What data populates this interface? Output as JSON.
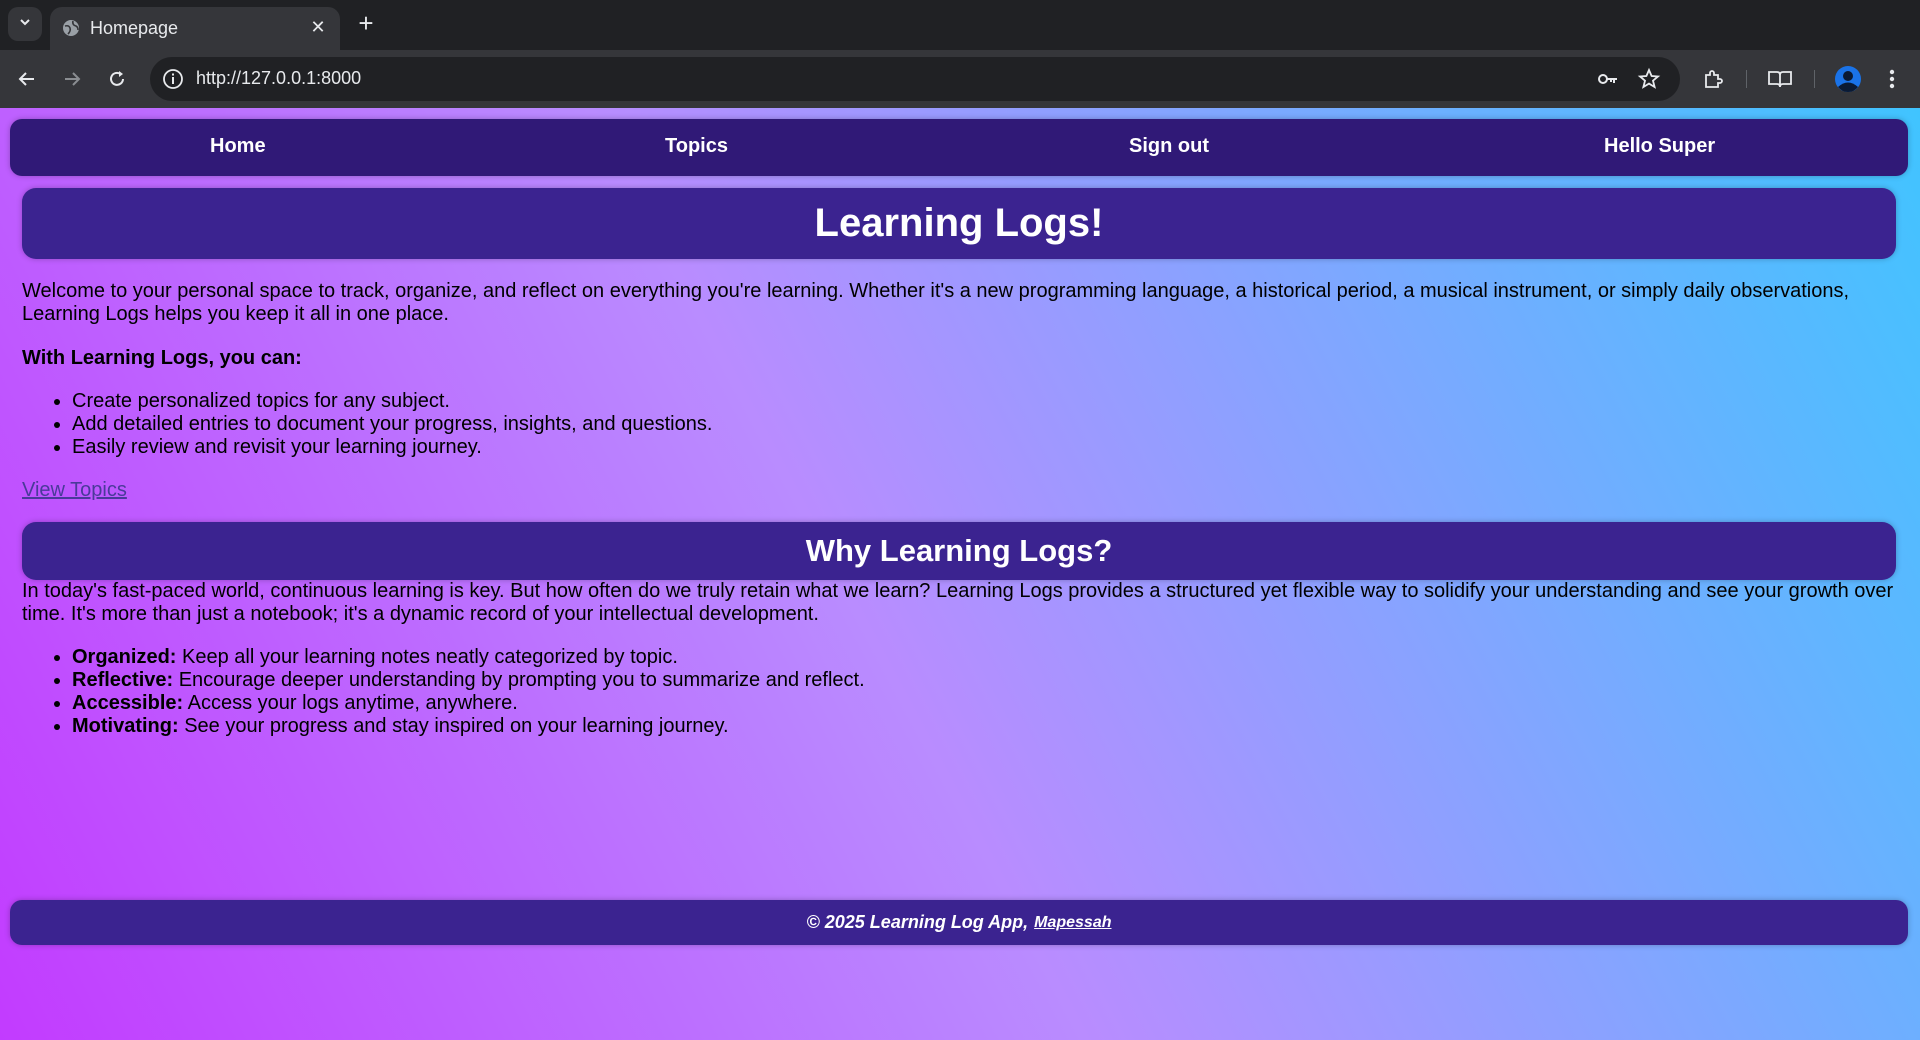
{
  "browser": {
    "tab_title": "Homepage",
    "url": "http://127.0.0.1:8000"
  },
  "navbar": {
    "home": "Home",
    "topics": "Topics",
    "sign_out": "Sign out",
    "greeting": "Hello Super"
  },
  "hero": {
    "title": "Learning Logs!"
  },
  "intro": {
    "paragraph": "Welcome to your personal space to track, organize, and reflect on everything you're learning. Whether it's a new programming language, a historical period, a musical instrument, or simply daily observations, Learning Logs helps you keep it all in one place.",
    "can_heading": "With Learning Logs, you can:",
    "features": [
      "Create personalized topics for any subject.",
      "Add detailed entries to document your progress, insights, and questions.",
      "Easily review and revisit your learning journey."
    ],
    "view_topics_link": "View Topics"
  },
  "why": {
    "title": "Why Learning Logs?",
    "paragraph": "In today's fast-paced world, continuous learning is key. But how often do we truly retain what we learn? Learning Logs provides a structured yet flexible way to solidify your understanding and see your growth over time. It's more than just a notebook; it's a dynamic record of your intellectual development.",
    "benefits": [
      {
        "term": "Organized:",
        "text": " Keep all your learning notes neatly categorized by topic."
      },
      {
        "term": "Reflective:",
        "text": " Encourage deeper understanding by prompting you to summarize and reflect."
      },
      {
        "term": "Accessible:",
        "text": " Access your logs anytime, anywhere."
      },
      {
        "term": "Motivating:",
        "text": " See your progress and stay inspired on your learning journey."
      }
    ]
  },
  "footer": {
    "text": "© 2025 Learning Log App,",
    "author_link": "Mapessah"
  },
  "colors": {
    "navbar_bg": "#301977",
    "banner_bg": "#3b2390",
    "gradient_start": "#c23bff",
    "gradient_end": "#40c4ff"
  }
}
